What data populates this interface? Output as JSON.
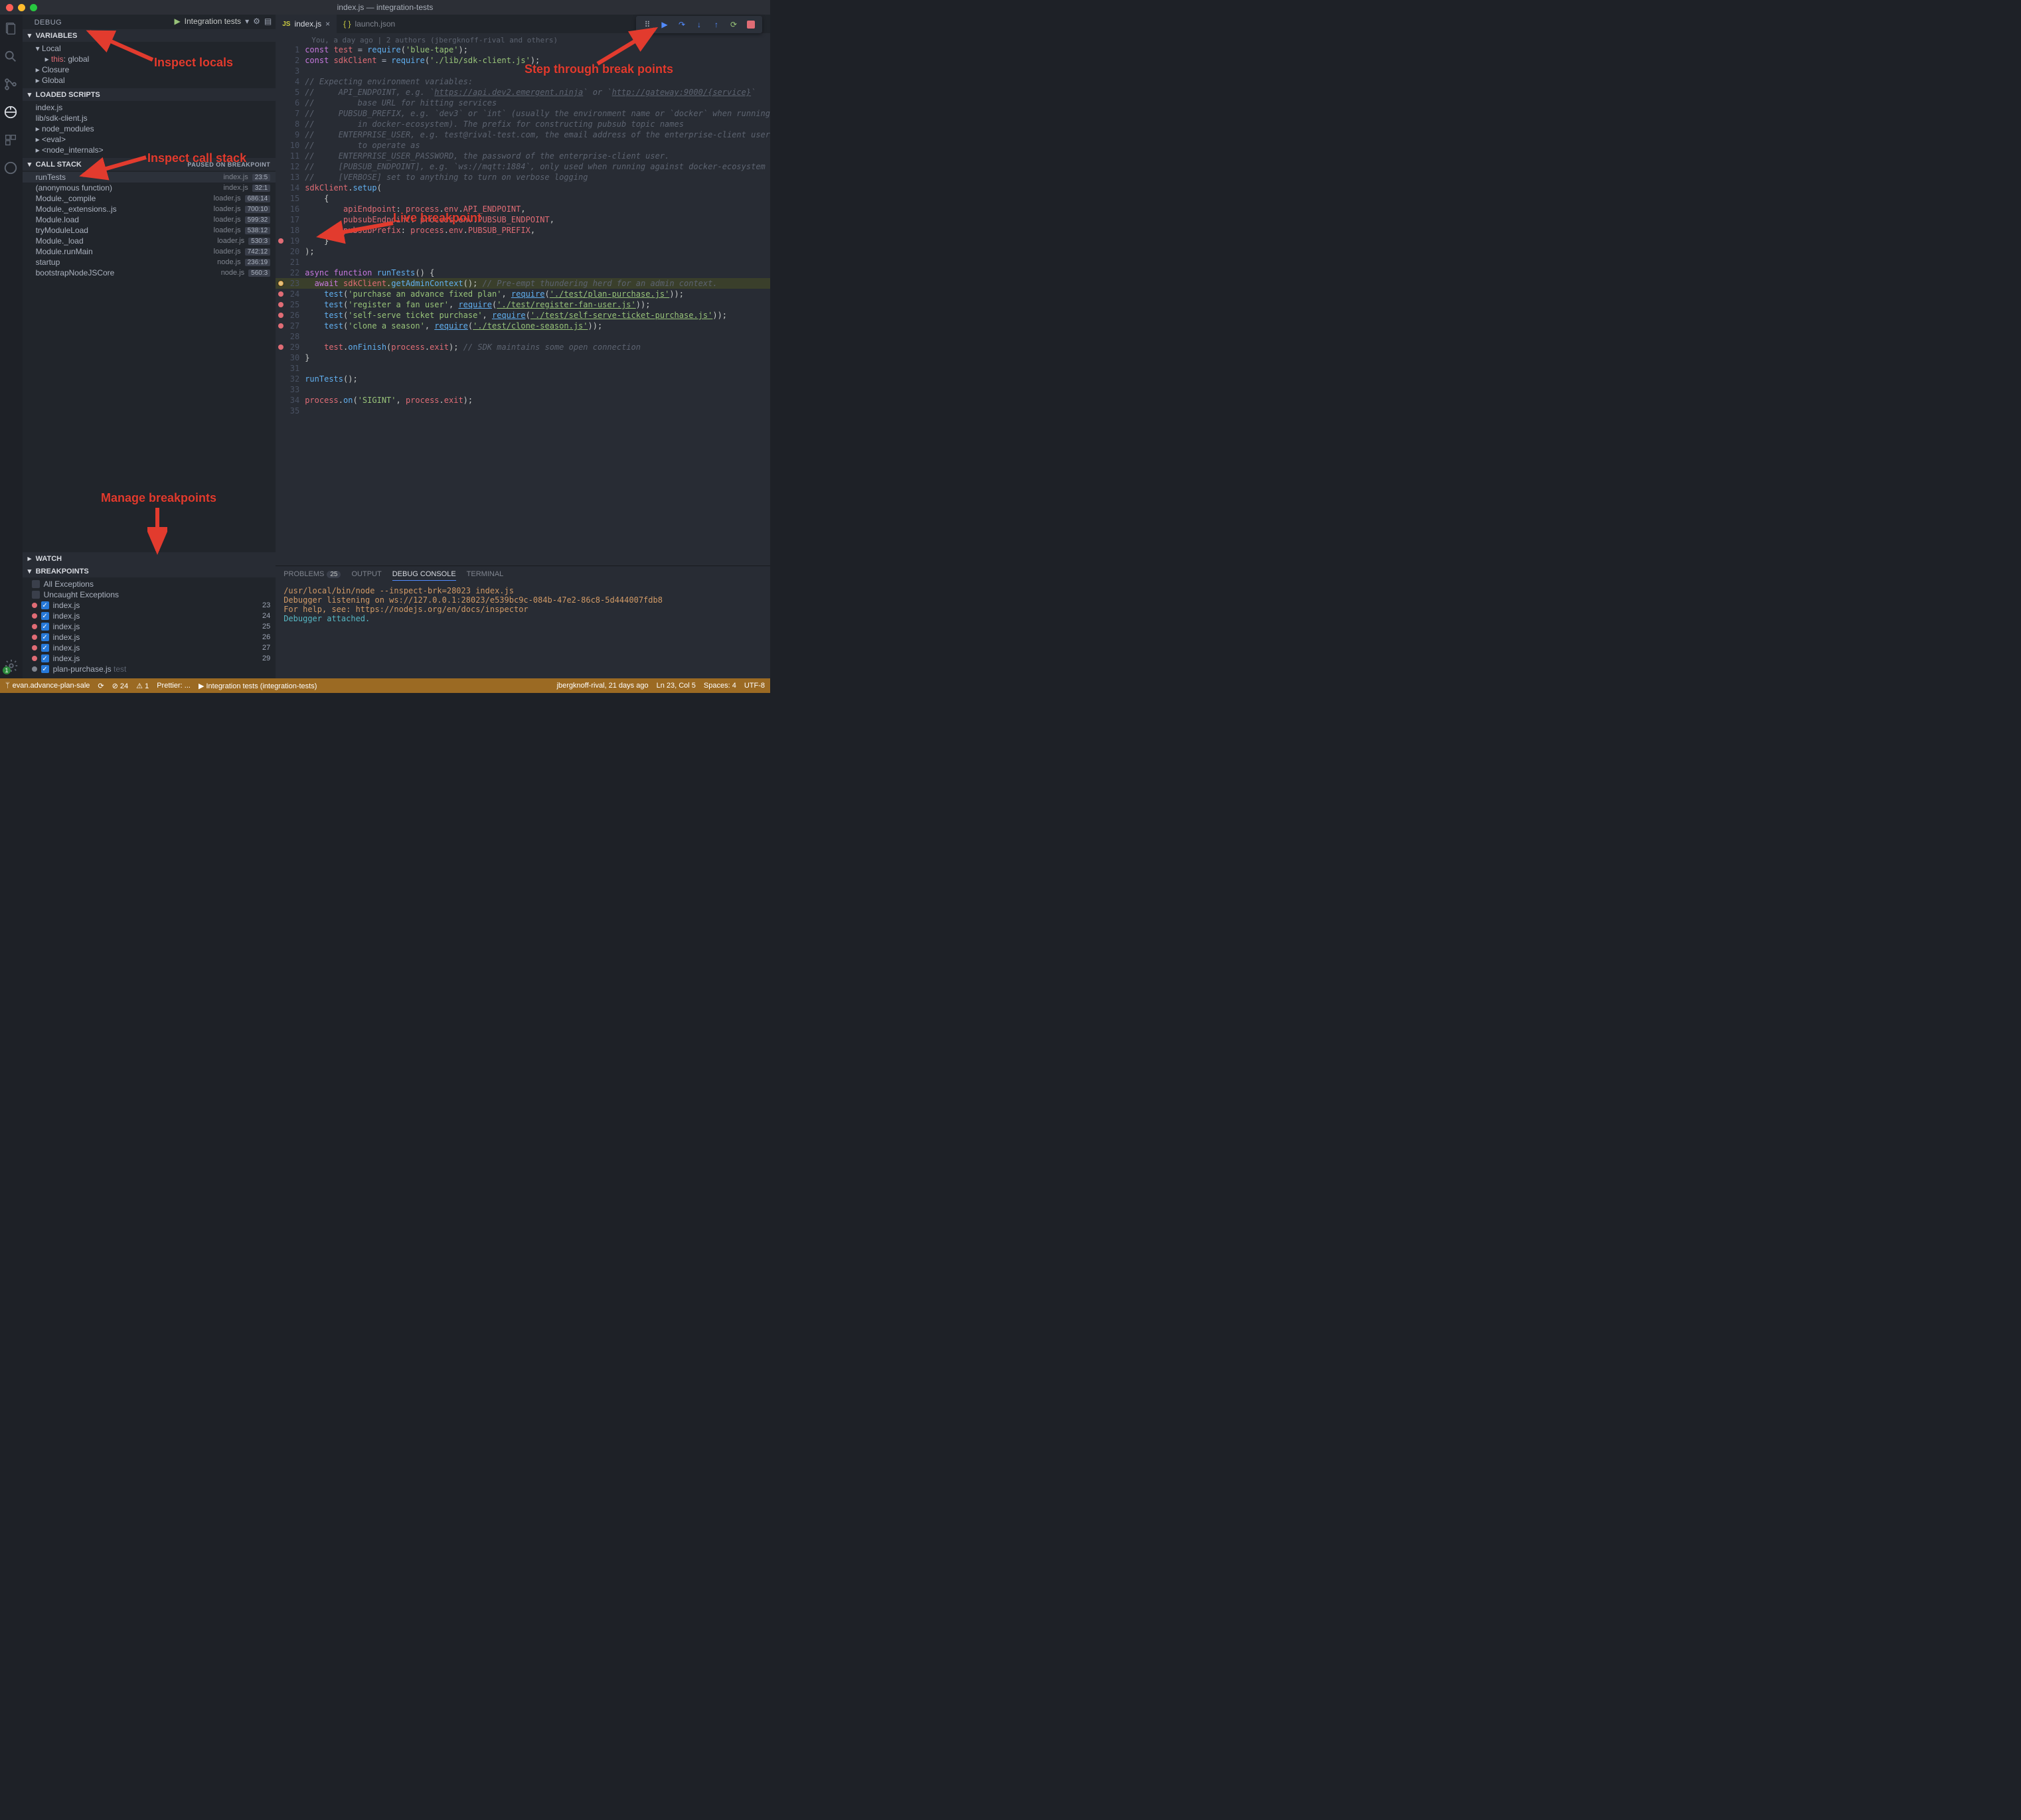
{
  "window_title": "index.js — integration-tests",
  "sidebar_title": "DEBUG",
  "debug_config": "Integration tests",
  "sections": {
    "variables": "VARIABLES",
    "local": "Local",
    "closure": "Closure",
    "global": "Global",
    "loaded_scripts": "LOADED SCRIPTS",
    "call_stack": "CALL STACK",
    "paused": "PAUSED ON BREAKPOINT",
    "watch": "WATCH",
    "breakpoints": "BREAKPOINTS"
  },
  "variables_local": {
    "key": "this",
    "val": "global"
  },
  "loaded_scripts": [
    "index.js",
    "lib/sdk-client.js",
    "node_modules",
    "<eval>",
    "<node_internals>"
  ],
  "call_stack": [
    {
      "fn": "runTests",
      "file": "index.js",
      "pos": "23:5",
      "sel": true
    },
    {
      "fn": "(anonymous function)",
      "file": "index.js",
      "pos": "32:1"
    },
    {
      "fn": "Module._compile",
      "file": "loader.js",
      "pos": "686:14"
    },
    {
      "fn": "Module._extensions..js",
      "file": "loader.js",
      "pos": "700:10"
    },
    {
      "fn": "Module.load",
      "file": "loader.js",
      "pos": "599:32"
    },
    {
      "fn": "tryModuleLoad",
      "file": "loader.js",
      "pos": "538:12"
    },
    {
      "fn": "Module._load",
      "file": "loader.js",
      "pos": "530:3"
    },
    {
      "fn": "Module.runMain",
      "file": "loader.js",
      "pos": "742:12"
    },
    {
      "fn": "startup",
      "file": "node.js",
      "pos": "236:19"
    },
    {
      "fn": "bootstrapNodeJSCore",
      "file": "node.js",
      "pos": "560:3"
    }
  ],
  "breakpoints": {
    "all_ex": "All Exceptions",
    "uncaught": "Uncaught Exceptions",
    "items": [
      {
        "file": "index.js",
        "line": "23"
      },
      {
        "file": "index.js",
        "line": "24"
      },
      {
        "file": "index.js",
        "line": "25"
      },
      {
        "file": "index.js",
        "line": "26"
      },
      {
        "file": "index.js",
        "line": "27"
      },
      {
        "file": "index.js",
        "line": "29"
      },
      {
        "file": "plan-purchase.js",
        "suffix": "test",
        "line": ""
      }
    ]
  },
  "tabs": [
    {
      "icon": "JS",
      "label": "index.js",
      "active": true,
      "close": true
    },
    {
      "icon": "{}",
      "label": "launch.json",
      "active": false
    }
  ],
  "blame": "You, a day ago | 2 authors (jbergknoff-rival and others)",
  "code_lines": [
    {
      "n": 1,
      "html": "<span class='k-purple'>const</span> <span class='k-red'>test</span> <span class='k-white'>=</span> <span class='k-blue'>require</span>(<span class='k-green'>'blue-tape'</span>);"
    },
    {
      "n": 2,
      "html": "<span class='k-purple'>const</span> <span class='k-red'>sdkClient</span> <span class='k-white'>=</span> <span class='k-blue'>require</span>(<span class='k-green'>'./lib/sdk-client.js'</span>);"
    },
    {
      "n": 3,
      "html": ""
    },
    {
      "n": 4,
      "html": "<span class='k-gray'>// Expecting environment variables:</span>"
    },
    {
      "n": 5,
      "html": "<span class='k-gray'>//     API_ENDPOINT, e.g. `<span class='ul'>https://api.dev2.emergent.ninja</span>` or `<span class='ul'>http://gateway:9000/{service}</span>`</span>"
    },
    {
      "n": 6,
      "html": "<span class='k-gray'>//         base URL for hitting services</span>"
    },
    {
      "n": 7,
      "html": "<span class='k-gray'>//     PUBSUB_PREFIX, e.g. `dev3` or `int` (usually the environment name or `docker` when running</span>"
    },
    {
      "n": 8,
      "html": "<span class='k-gray'>//         in docker-ecosystem). The prefix for constructing pubsub topic names</span>"
    },
    {
      "n": 9,
      "html": "<span class='k-gray'>//     ENTERPRISE_USER, e.g. test@rival-test.com, the email address of the enterprise-client user</span>"
    },
    {
      "n": 10,
      "html": "<span class='k-gray'>//         to operate as</span>"
    },
    {
      "n": 11,
      "html": "<span class='k-gray'>//     ENTERPRISE_USER_PASSWORD, the password of the enterprise-client user.</span>"
    },
    {
      "n": 12,
      "html": "<span class='k-gray'>//     [PUBSUB_ENDPOINT], e.g. `ws://mqtt:1884`, only used when running against docker-ecosystem</span>"
    },
    {
      "n": 13,
      "html": "<span class='k-gray'>//     [VERBOSE] set to anything to turn on verbose logging</span>"
    },
    {
      "n": 14,
      "html": "<span class='k-red'>sdkClient</span>.<span class='k-blue'>setup</span>("
    },
    {
      "n": 15,
      "html": "    {"
    },
    {
      "n": 16,
      "html": "        <span class='k-red'>apiEndpoint</span>: <span class='k-red'>process</span>.<span class='k-red'>env</span>.<span class='k-red'>API_ENDPOINT</span>,"
    },
    {
      "n": 17,
      "html": "        <span class='k-red'>pubsubEndpoint</span>: <span class='k-red'>process</span>.<span class='k-red'>env</span>.<span class='k-red'>PUBSUB_ENDPOINT</span>,"
    },
    {
      "n": 18,
      "html": "        <span class='k-red'>pubsubPrefix</span>: <span class='k-red'>process</span>.<span class='k-red'>env</span>.<span class='k-red'>PUBSUB_PREFIX</span>,"
    },
    {
      "n": 19,
      "bp": true,
      "html": "    }"
    },
    {
      "n": 20,
      "html": ");"
    },
    {
      "n": 21,
      "html": ""
    },
    {
      "n": 22,
      "html": "<span class='k-purple'>async function</span> <span class='k-blue'>runTests</span>() {"
    },
    {
      "n": 23,
      "bp": "cur",
      "hl": true,
      "html": "<span style='background:#3a3f2b'>  <span class='k-purple'>await</span> <span class='k-red'>sdkClient</span>.<span class='k-blue'>getAdminContext</span>();</span> <span class='k-gray'>// Pre-empt thundering herd for an admin context.</span>"
    },
    {
      "n": 24,
      "bp": true,
      "html": "    <span class='k-blue'>test</span>(<span class='k-green'>'purchase an advance fixed plan'</span>, <span class='k-blue ul'>require</span>(<span class='k-green ul'>'./test/plan-purchase.js'</span>));"
    },
    {
      "n": 25,
      "bp": true,
      "html": "    <span class='k-blue'>test</span>(<span class='k-green'>'register a fan user'</span>, <span class='k-blue ul'>require</span>(<span class='k-green ul'>'./test/register-fan-user.js'</span>));"
    },
    {
      "n": 26,
      "bp": true,
      "html": "    <span class='k-blue'>test</span>(<span class='k-green'>'self-serve ticket purchase'</span>, <span class='k-blue ul'>require</span>(<span class='k-green ul'>'./test/self-serve-ticket-purchase.js'</span>));"
    },
    {
      "n": 27,
      "bp": true,
      "html": "    <span class='k-blue'>test</span>(<span class='k-green'>'clone a season'</span>, <span class='k-blue ul'>require</span>(<span class='k-green ul'>'./test/clone-season.js'</span>));"
    },
    {
      "n": 28,
      "html": ""
    },
    {
      "n": 29,
      "bp": true,
      "html": "    <span class='k-red'>test</span>.<span class='k-blue'>onFinish</span>(<span class='k-red'>process</span>.<span class='k-red'>exit</span>); <span class='k-gray'>// SDK maintains some open connection</span>"
    },
    {
      "n": 30,
      "html": "}"
    },
    {
      "n": 31,
      "html": ""
    },
    {
      "n": 32,
      "html": "<span class='k-blue'>runTests</span>();"
    },
    {
      "n": 33,
      "html": ""
    },
    {
      "n": 34,
      "html": "<span class='k-red'>process</span>.<span class='k-blue'>on</span>(<span class='k-green'>'SIGINT'</span>, <span class='k-red'>process</span>.<span class='k-red'>exit</span>);"
    },
    {
      "n": 35,
      "html": ""
    }
  ],
  "panel": {
    "tabs": {
      "problems": "PROBLEMS",
      "problems_count": "25",
      "output": "OUTPUT",
      "debug": "DEBUG CONSOLE",
      "terminal": "TERMINAL"
    },
    "lines": [
      {
        "cls": "pc-yellow",
        "t": "/usr/local/bin/node --inspect-brk=28023 index.js"
      },
      {
        "cls": "pc-yellow",
        "t": "Debugger listening on ws://127.0.0.1:28023/e539bc9c-084b-47e2-86c8-5d444007fdb8"
      },
      {
        "cls": "pc-yellow",
        "t": "For help, see: https://nodejs.org/en/docs/inspector"
      },
      {
        "cls": "pc-blue",
        "t": "Debugger attached."
      }
    ]
  },
  "statusbar": {
    "branch": "evan.advance-plan-sale",
    "sync": "⟳",
    "errors": "⊘ 24",
    "warnings": "⚠ 1",
    "prettier": "Prettier: ...",
    "launch": "▶ Integration tests (integration-tests)",
    "blame_r": "jbergknoff-rival, 21 days ago",
    "pos": "Ln 23, Col 5",
    "spaces": "Spaces: 4",
    "enc": "UTF-8"
  },
  "annotations": {
    "inspect_locals": "Inspect locals",
    "inspect_stack": "Inspect call stack",
    "live_bp": "Live breakpoint",
    "step": "Step through break points",
    "manage": "Manage breakpoints"
  }
}
